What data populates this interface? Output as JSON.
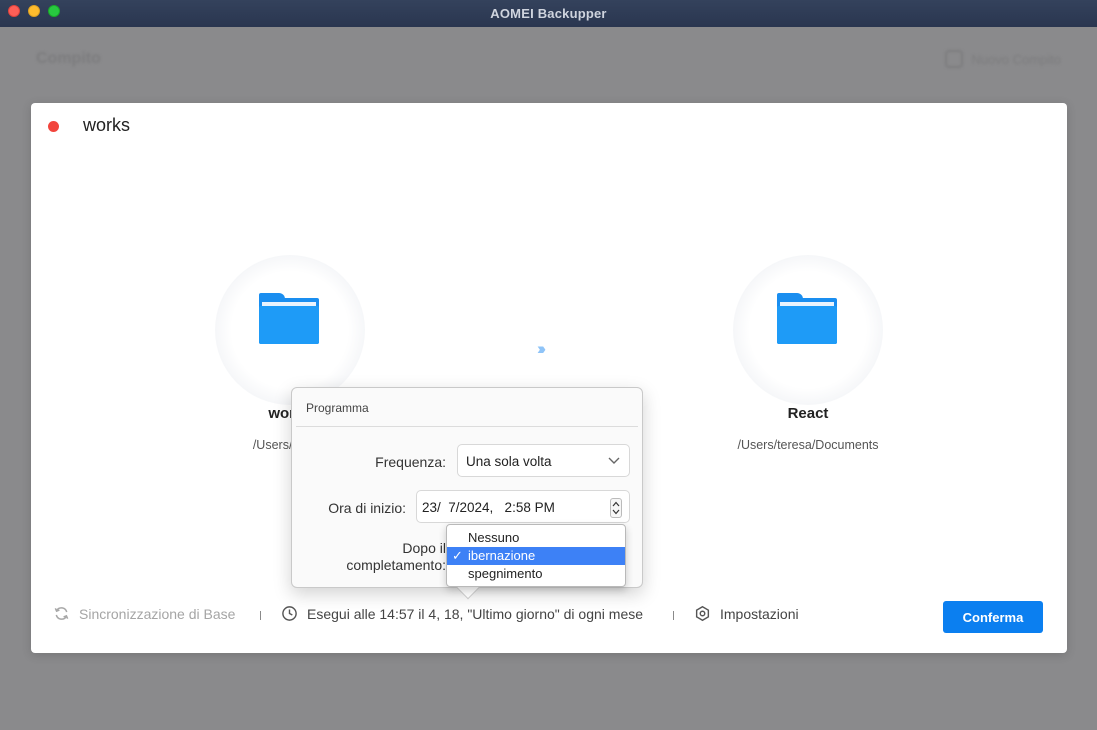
{
  "window": {
    "title": "AOMEI Backupper"
  },
  "background": {
    "page_title": "Compito",
    "header_button": "Nuovo Compito"
  },
  "task": {
    "name": "works",
    "status_color": "#f2453d"
  },
  "source": {
    "name": "works",
    "path": "/Users/teresa"
  },
  "destination": {
    "name": "React",
    "path": "/Users/teresa/Documents"
  },
  "footer": {
    "sync_mode": "Sincronizzazione di Base",
    "schedule": "Esegui alle 14:57 il 4, 18, \"Ultimo giorno\" di ogni mese",
    "settings": "Impostazioni",
    "confirm": "Conferma"
  },
  "schedule_popover": {
    "title": "Programma",
    "frequency_label": "Frequenza:",
    "frequency_value": "Una sola volta",
    "start_label": "Ora di inizio:",
    "start_value": "23/  7/2024,   2:58 PM",
    "after_label_1": "Dopo il",
    "after_label_2": "completamento:",
    "after_options": [
      {
        "label": "Nessuno",
        "selected": false
      },
      {
        "label": "ibernazione",
        "selected": true
      },
      {
        "label": "spegnimento",
        "selected": false
      }
    ],
    "checkmark": "✓"
  },
  "colors": {
    "accent": "#0b7ff0",
    "folder": "#1e9bf7",
    "menu_highlight": "#3d81f6"
  }
}
